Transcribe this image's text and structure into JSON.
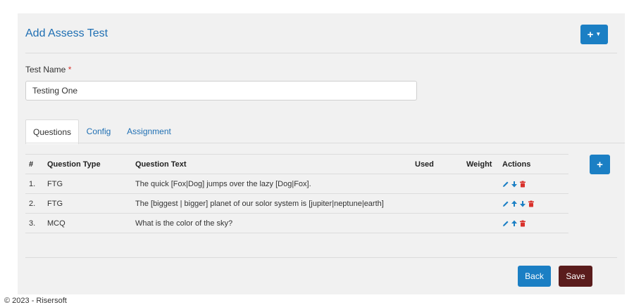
{
  "page": {
    "title": "Add Assess Test"
  },
  "header": {
    "add_menu_icon": "plus-icon",
    "add_menu_caret": "caret-down-icon"
  },
  "form": {
    "test_name_label": "Test Name",
    "required_marker": "*",
    "test_name_value": "Testing One"
  },
  "tabs": [
    {
      "label": "Questions",
      "active": true
    },
    {
      "label": "Config",
      "active": false
    },
    {
      "label": "Assignment",
      "active": false
    }
  ],
  "table": {
    "headers": {
      "num": "#",
      "type": "Question Type",
      "text": "Question Text",
      "used": "Used",
      "weight": "Weight",
      "actions": "Actions"
    },
    "rows": [
      {
        "num": "1.",
        "type": "FTG",
        "text": "The quick [Fox|Dog] jumps over the lazy [Dog|Fox].",
        "used": "",
        "weight": "",
        "actions": [
          "edit-icon",
          "arrow-down-icon",
          "delete-icon"
        ]
      },
      {
        "num": "2.",
        "type": "FTG",
        "text": "The [biggest | bigger] planet of our solor system is [jupiter|neptune|earth]",
        "used": "",
        "weight": "",
        "actions": [
          "edit-icon",
          "arrow-up-icon",
          "arrow-down-icon",
          "delete-icon"
        ]
      },
      {
        "num": "3.",
        "type": "MCQ",
        "text": "What is the color of the sky?",
        "used": "",
        "weight": "",
        "actions": [
          "edit-icon",
          "arrow-up-icon",
          "delete-icon"
        ]
      }
    ]
  },
  "buttons": {
    "back": "Back",
    "save": "Save",
    "add_question_icon": "plus-icon"
  },
  "colors": {
    "primary": "#1b7fc4",
    "save": "#5a1c1c",
    "title": "#1f6fb3",
    "delete": "#d9312b"
  },
  "footer": {
    "text": "© 2023 - Risersoft"
  }
}
